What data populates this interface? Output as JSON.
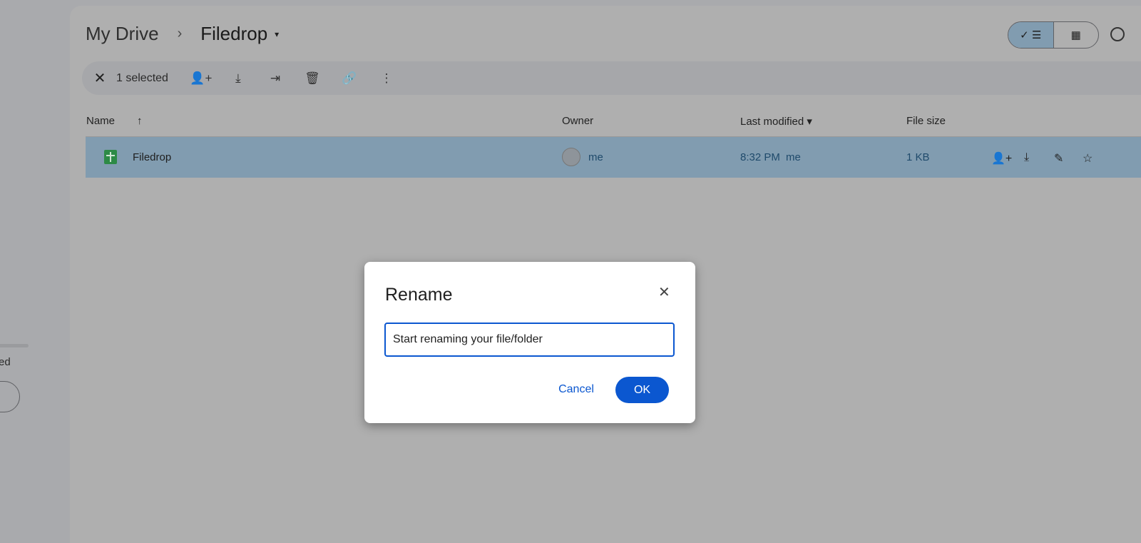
{
  "sidebar": {
    "partial_text": "ed"
  },
  "breadcrumb": {
    "root": "My Drive",
    "separator": "›",
    "current": "Filedrop",
    "caret": "▾"
  },
  "view_toggle": {
    "list_label": "✓ ☰",
    "grid_label": "▦"
  },
  "toolbar": {
    "close": "✕",
    "selected_count": "1 selected",
    "icons": [
      "share-icon",
      "download-icon",
      "move-icon",
      "delete-icon",
      "link-icon",
      "more-icon"
    ],
    "glyphs": [
      "👤+",
      "⤓",
      "⇥",
      "🗑",
      "🔗",
      "⋮"
    ]
  },
  "table": {
    "columns": {
      "name": "Name",
      "name_sort": "↑",
      "owner": "Owner",
      "modified": "Last modified ▾",
      "size": "File size"
    },
    "rows": [
      {
        "name": "Filedrop",
        "owner": "me",
        "modified": "8:32 PM",
        "modified_by": "me",
        "size": "1 KB",
        "actions": [
          "👤+",
          "⤓",
          "✎",
          "☆"
        ]
      }
    ]
  },
  "dialog": {
    "title": "Rename",
    "close": "✕",
    "input_value": "Start renaming your file/folder",
    "cancel": "Cancel",
    "ok": "OK"
  },
  "colors": {
    "selected_row": "#819cb0",
    "primary": "#0b57d0",
    "sheet_icon": "#2d8a46"
  }
}
